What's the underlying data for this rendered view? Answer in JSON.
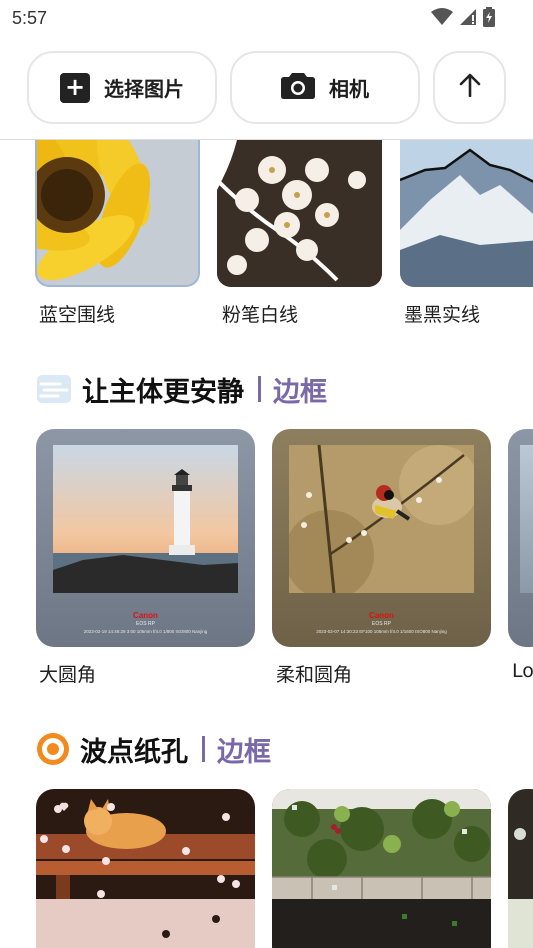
{
  "status": {
    "time": "5:57"
  },
  "toolbar": {
    "pick_label": "选择图片",
    "camera_label": "相机"
  },
  "outline_row": {
    "items": [
      {
        "label": "蓝空围线"
      },
      {
        "label": "粉笔白线"
      },
      {
        "label": "墨黑实线"
      }
    ]
  },
  "frame_section": {
    "title": "让主体更安静",
    "tag": "边框",
    "items": [
      {
        "label": "大圆角",
        "brand": "Canon",
        "model": "EOS RP",
        "meta": "2023-02-19 14:46:29 3:00  105mm f/4.0 1/800 ISO800  Nanjing"
      },
      {
        "label": "柔和圆角",
        "brand": "Canon",
        "model": "EOS RP",
        "meta": "2023-02-07 14:30:23 EF100  105mm f/4.0 1/1600 ISO800  Nanjing"
      },
      {
        "label": "Lo"
      }
    ]
  },
  "dots_section": {
    "title": "波点纸孔",
    "tag": "边框"
  },
  "colors": {
    "accent": "#7a68a8",
    "border": "#e6e6e6"
  }
}
